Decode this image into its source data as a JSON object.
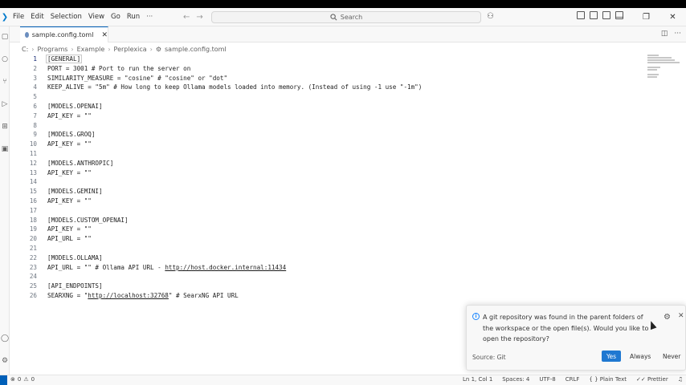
{
  "titlebar": {
    "menu": [
      "File",
      "Edit",
      "Selection",
      "View",
      "Go",
      "Run"
    ],
    "more": "···",
    "search_label": "Search"
  },
  "tab": {
    "label": "sample.config.toml",
    "close": "✕"
  },
  "breadcrumb": [
    "C:",
    "Programs",
    "Example",
    "Perplexica",
    "sample.config.toml"
  ],
  "code": {
    "active_line": 1,
    "lines": [
      {
        "n": "1",
        "text": "[GENERAL]"
      },
      {
        "n": "2",
        "text": "PORT = 3001 # Port to run the server on"
      },
      {
        "n": "3",
        "text": "SIMILARITY_MEASURE = \"cosine\" # \"cosine\" or \"dot\""
      },
      {
        "n": "4",
        "text": "KEEP_ALIVE = \"5m\" # How long to keep Ollama models loaded into memory. (Instead of using -1 use \"-1m\")"
      },
      {
        "n": "5",
        "text": ""
      },
      {
        "n": "6",
        "text": "[MODELS.OPENAI]"
      },
      {
        "n": "7",
        "text": "API_KEY = \"\""
      },
      {
        "n": "8",
        "text": ""
      },
      {
        "n": "9",
        "text": "[MODELS.GROQ]"
      },
      {
        "n": "10",
        "text": "API_KEY = \"\""
      },
      {
        "n": "11",
        "text": ""
      },
      {
        "n": "12",
        "text": "[MODELS.ANTHROPIC]"
      },
      {
        "n": "13",
        "text": "API_KEY = \"\""
      },
      {
        "n": "14",
        "text": ""
      },
      {
        "n": "15",
        "text": "[MODELS.GEMINI]"
      },
      {
        "n": "16",
        "text": "API_KEY = \"\""
      },
      {
        "n": "17",
        "text": ""
      },
      {
        "n": "18",
        "text": "[MODELS.CUSTOM_OPENAI]"
      },
      {
        "n": "19",
        "text": "API_KEY = \"\""
      },
      {
        "n": "20",
        "text": "API_URL = \"\""
      },
      {
        "n": "21",
        "text": ""
      },
      {
        "n": "22",
        "text": "[MODELS.OLLAMA]"
      },
      {
        "n": "23",
        "text": "API_URL = \"\" # Ollama API URL - ",
        "link": "http://host.docker.internal:11434"
      },
      {
        "n": "24",
        "text": ""
      },
      {
        "n": "25",
        "text": "[API_ENDPOINTS]"
      },
      {
        "n": "26",
        "text": "SEARXNG = \"",
        "link": "http://localhost:32768",
        "after": "\" # SearxNG API URL"
      }
    ]
  },
  "notification": {
    "message": "A git repository was found in the parent folders of the workspace or the open file(s). Would you like to open the repository?",
    "source": "Source: Git",
    "yes": "Yes",
    "always": "Always",
    "never": "Never"
  },
  "status": {
    "errors": "0",
    "warnings": "0",
    "position": "Ln 1, Col 1",
    "spaces": "Spaces: 4",
    "encoding": "UTF-8",
    "eol": "CRLF",
    "language": "Plain Text",
    "formatter": "Prettier"
  },
  "colors": {
    "accent": "#005fb8",
    "button": "#1f78d1"
  }
}
